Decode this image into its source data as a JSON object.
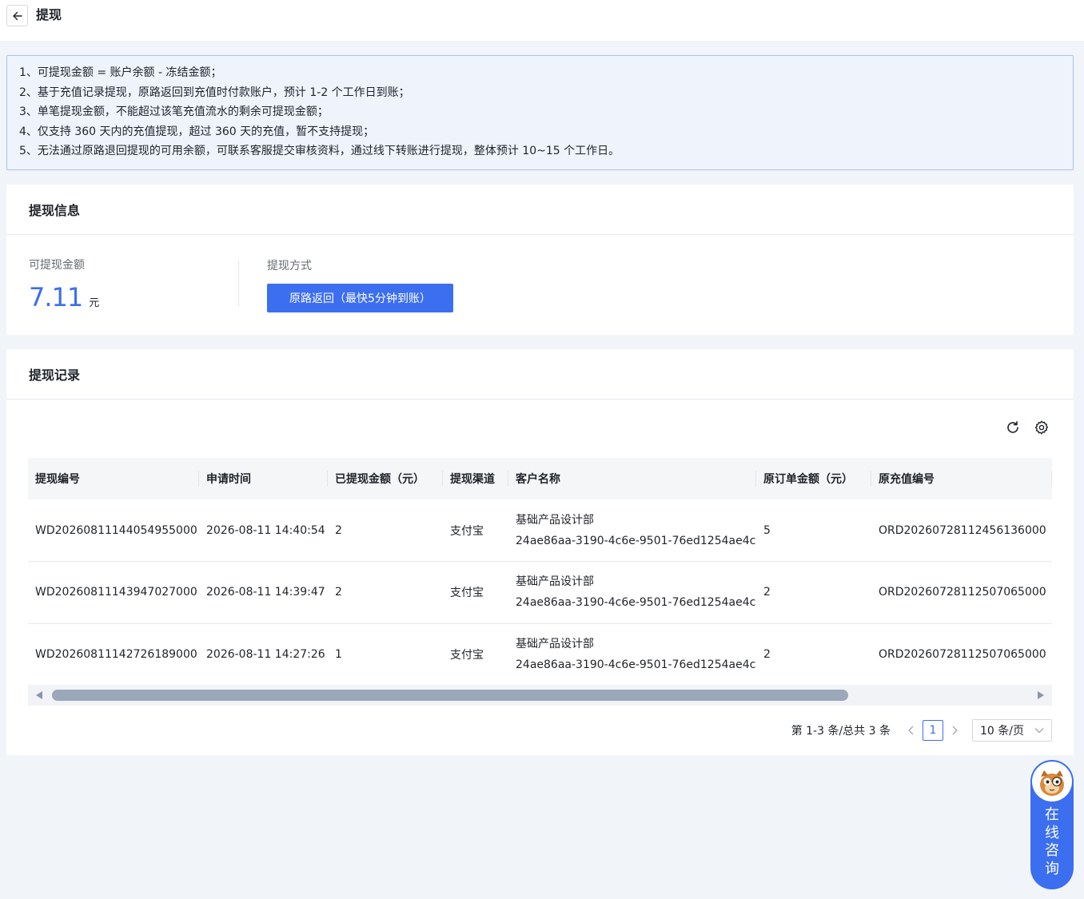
{
  "header": {
    "title": "提现"
  },
  "notice": {
    "lines": [
      "1、可提现金额 = 账户余额 - 冻结金额；",
      "2、基于充值记录提现，原路返回到充值时付款账户，预计 1-2 个工作日到账；",
      "3、单笔提现金额，不能超过该笔充值流水的剩余可提现金额；",
      "4、仅支持 360 天内的充值提现，超过 360 天的充值，暂不支持提现；",
      "5、无法通过原路退回提现的可用余额，可联系客服提交审核资料，通过线下转账进行提现，整体预计 10~15 个工作日。"
    ]
  },
  "withdraw_info": {
    "title": "提现信息",
    "amount_label": "可提现金额",
    "amount": "7.11",
    "amount_unit": "元",
    "method_label": "提现方式",
    "method_button": "原路返回（最快5分钟到账）"
  },
  "records": {
    "title": "提现记录",
    "columns": [
      "提现编号",
      "申请时间",
      "已提现金额（元）",
      "提现渠道",
      "客户名称",
      "原订单金额（元）",
      "原充值编号"
    ],
    "rows": [
      {
        "id": "WD20260811144054955000",
        "time": "2026-08-11 14:40:54",
        "amount": "2",
        "channel": "支付宝",
        "customer_name": "基础产品设计部",
        "customer_id": "24ae86aa-3190-4c6e-9501-76ed1254ae4c",
        "order_amount": "5",
        "recharge_id": "ORD20260728112456136000"
      },
      {
        "id": "WD20260811143947027000",
        "time": "2026-08-11 14:39:47",
        "amount": "2",
        "channel": "支付宝",
        "customer_name": "基础产品设计部",
        "customer_id": "24ae86aa-3190-4c6e-9501-76ed1254ae4c",
        "order_amount": "2",
        "recharge_id": "ORD20260728112507065000"
      },
      {
        "id": "WD20260811142726189000",
        "time": "2026-08-11 14:27:26",
        "amount": "1",
        "channel": "支付宝",
        "customer_name": "基础产品设计部",
        "customer_id": "24ae86aa-3190-4c6e-9501-76ed1254ae4c",
        "order_amount": "2",
        "recharge_id": "ORD20260728112507065000"
      }
    ],
    "pagination": {
      "total_text": "第 1-3 条/总共 3 条",
      "current_page": "1",
      "page_size": "10 条/页"
    }
  },
  "consult": {
    "label": "在线咨询"
  },
  "colors": {
    "primary": "#3c6ef0",
    "notice_bg": "#eef3fc",
    "notice_border": "#a9c3f1"
  }
}
